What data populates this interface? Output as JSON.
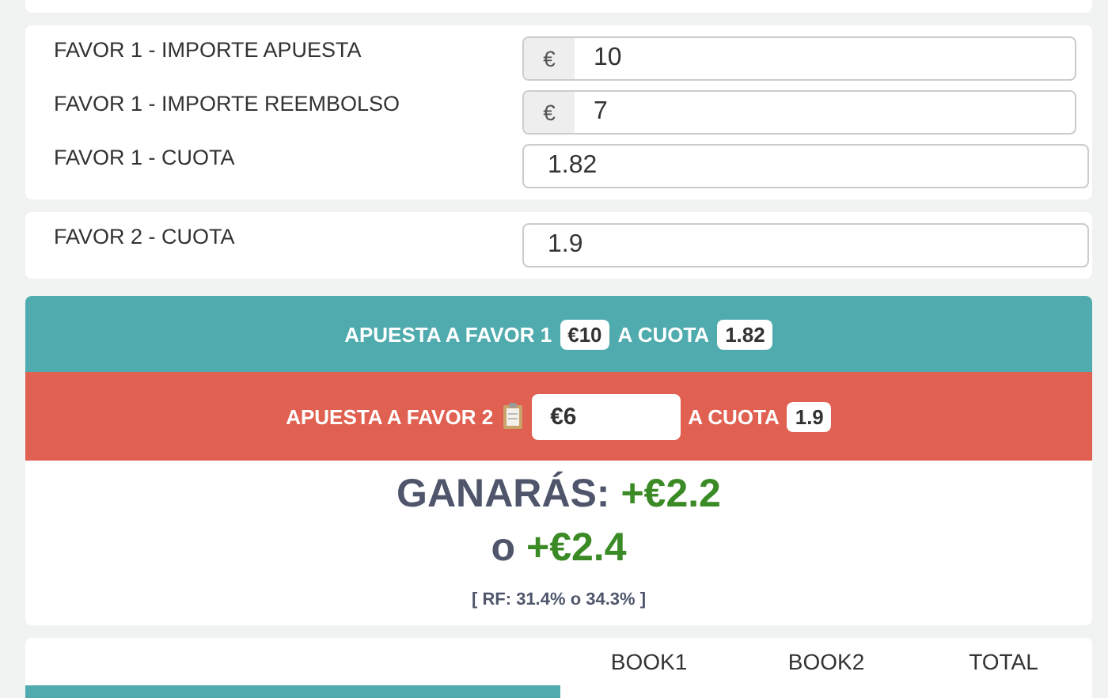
{
  "fields": [
    {
      "label": "FAVOR 1 - IMPORTE APUESTA",
      "prefix": "€",
      "value": "10"
    },
    {
      "label": "FAVOR 1 - IMPORTE REEMBOLSO",
      "prefix": "€",
      "value": "7"
    },
    {
      "label": "FAVOR 1 - CUOTA",
      "value": "1.82"
    }
  ],
  "fields2": [
    {
      "label": "FAVOR 2 - CUOTA",
      "value": "1.9"
    }
  ],
  "bet1": {
    "label": "APUESTA A FAVOR 1",
    "amount": "€10",
    "odds_label": "A CUOTA",
    "odds": "1.82"
  },
  "bet2": {
    "label": "APUESTA A FAVOR 2",
    "amount": "€6",
    "odds_label": "A CUOTA",
    "odds": "1.9"
  },
  "result": {
    "label": "GANARÁS:",
    "value1": "+€2.2",
    "connector": "o",
    "value2": "+€2.4",
    "rf": "[ RF: 31.4% o 34.3% ]"
  },
  "table": {
    "columns": [
      "BOOK1",
      "BOOK2",
      "TOTAL"
    ]
  }
}
